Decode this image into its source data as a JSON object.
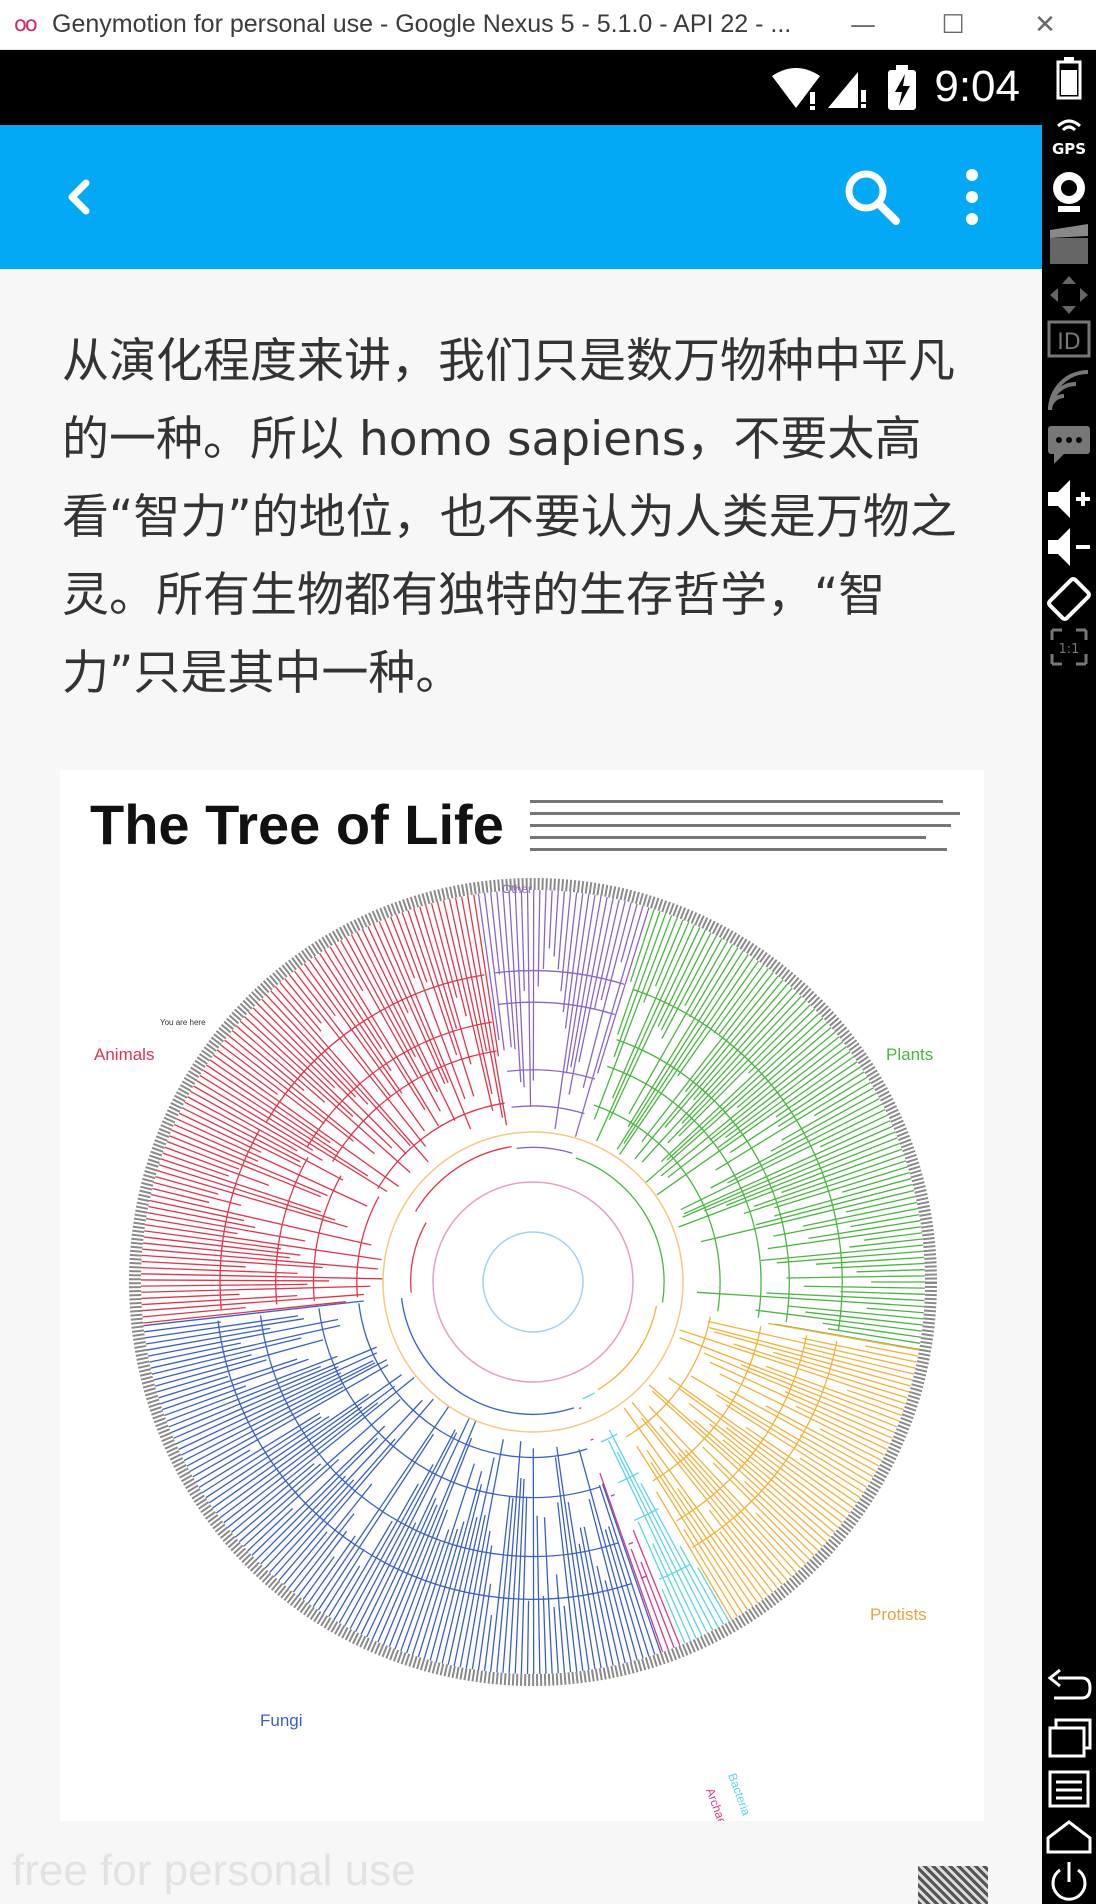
{
  "window": {
    "logo": "oo",
    "title": "Genymotion for personal use - Google Nexus 5 - 5.1.0 - API 22 - ...",
    "minimize": "—",
    "maximize": "☐",
    "close": "✕"
  },
  "statusbar": {
    "time": "9:04"
  },
  "appbar": {
    "back_icon": "chevron-left-icon",
    "search_icon": "search-icon",
    "more_icon": "more-vert-icon"
  },
  "article": {
    "paragraph": "从演化程度来讲，我们只是数万物种中平凡的一种。所以 homo sapiens，不要太高看“智力”的地位，也不要认为人类是万物之灵。所有生物都有独特的生存哲学，“智力”只是其中一种。"
  },
  "figure": {
    "title": "The Tree of Life",
    "labels": {
      "other": "Other",
      "you_are_here": "You are here",
      "animals": "Animals",
      "plants": "Plants",
      "fungi": "Fungi",
      "protists": "Protists",
      "bacteria": "Bacteria",
      "archaea": "Archaea"
    },
    "colors": {
      "animals": "#e2354a",
      "plants": "#4ab541",
      "fungi": "#3a5fc9",
      "protists": "#f0b23c",
      "other": "#8a64c8",
      "bacteria": "#5fd3e8",
      "archaea": "#d43d8c"
    }
  },
  "watermark": "free for personal use",
  "sidebar": {
    "gps_label": "GPS",
    "id_label": "ID",
    "ratio_label": "1:1"
  }
}
